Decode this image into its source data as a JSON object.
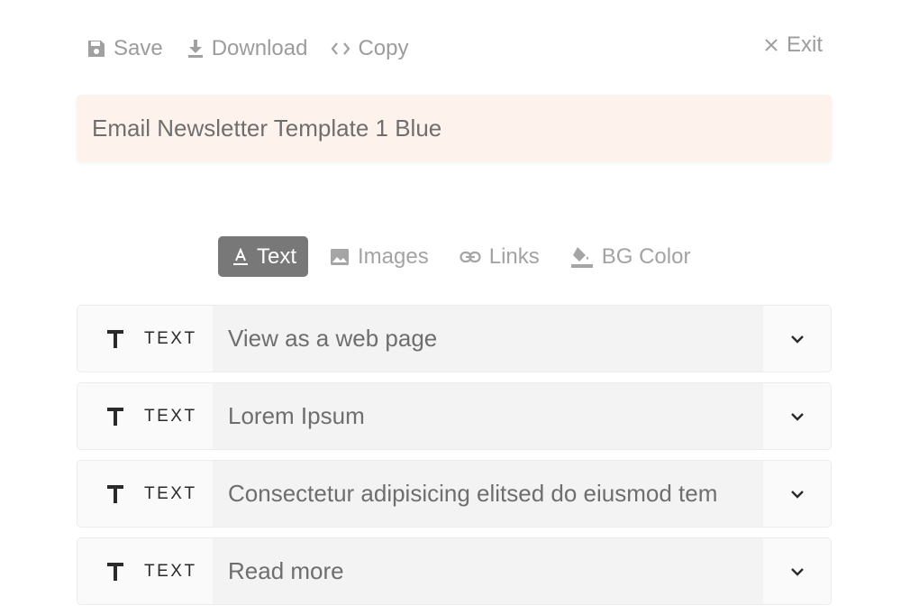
{
  "toolbar": {
    "save_label": "Save",
    "download_label": "Download",
    "copy_label": "Copy",
    "exit_label": "Exit"
  },
  "template_title": "Email Newsletter Template 1 Blue",
  "tabs": [
    {
      "label": "Text",
      "icon": "text-format-icon",
      "active": true
    },
    {
      "label": "Images",
      "icon": "image-icon",
      "active": false
    },
    {
      "label": "Links",
      "icon": "link-icon",
      "active": false
    },
    {
      "label": "BG Color",
      "icon": "paint-bucket-icon",
      "active": false
    }
  ],
  "blocks": [
    {
      "type": "TEXT",
      "content": "View as a web page"
    },
    {
      "type": "TEXT",
      "content": "Lorem Ipsum"
    },
    {
      "type": "TEXT",
      "content": "Consectetur adipisicing elitsed do eiusmod tem"
    },
    {
      "type": "TEXT",
      "content": "Read more"
    }
  ],
  "colors": {
    "title_bar_bg": "#fdf3ec",
    "active_tab_bg": "#787878",
    "muted_text": "#9c9c9c"
  }
}
